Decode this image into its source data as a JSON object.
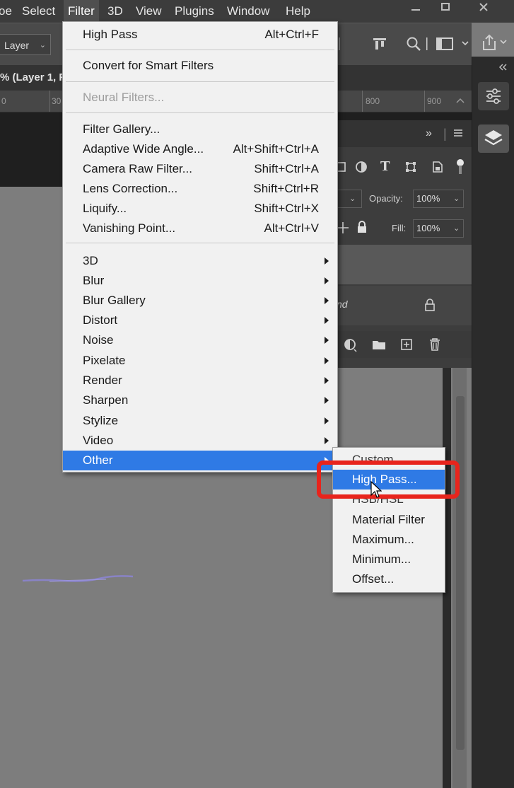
{
  "menubar": {
    "items": [
      {
        "label": "oe"
      },
      {
        "label": "Select"
      },
      {
        "label": "Filter"
      },
      {
        "label": "3D"
      },
      {
        "label": "View"
      },
      {
        "label": "Plugins"
      },
      {
        "label": "Window"
      },
      {
        "label": "Help"
      }
    ],
    "active_index": 2
  },
  "optionsbar": {
    "layer_select": "Layer"
  },
  "document": {
    "tab_title": "% (Layer 1, R"
  },
  "ruler": {
    "labels": [
      "0",
      "30",
      "800",
      "900"
    ]
  },
  "layers_panel": {
    "opacity_label": "Opacity:",
    "opacity_value": "100%",
    "fill_label": "Fill:",
    "fill_value": "100%",
    "background_layer_name": "nd"
  },
  "filter_menu": {
    "items": [
      {
        "label": "High Pass",
        "shortcut": "Alt+Ctrl+F"
      },
      {
        "label": "Convert for Smart Filters",
        "shortcut": ""
      },
      {
        "label": "Neural Filters...",
        "shortcut": "",
        "disabled": true
      },
      {
        "label": "Filter Gallery...",
        "shortcut": ""
      },
      {
        "label": "Adaptive Wide Angle...",
        "shortcut": "Alt+Shift+Ctrl+A"
      },
      {
        "label": "Camera Raw Filter...",
        "shortcut": "Shift+Ctrl+A"
      },
      {
        "label": "Lens Correction...",
        "shortcut": "Shift+Ctrl+R"
      },
      {
        "label": "Liquify...",
        "shortcut": "Shift+Ctrl+X"
      },
      {
        "label": "Vanishing Point...",
        "shortcut": "Alt+Ctrl+V"
      },
      {
        "label": "3D",
        "submenu": true
      },
      {
        "label": "Blur",
        "submenu": true
      },
      {
        "label": "Blur Gallery",
        "submenu": true
      },
      {
        "label": "Distort",
        "submenu": true
      },
      {
        "label": "Noise",
        "submenu": true
      },
      {
        "label": "Pixelate",
        "submenu": true
      },
      {
        "label": "Render",
        "submenu": true
      },
      {
        "label": "Sharpen",
        "submenu": true
      },
      {
        "label": "Stylize",
        "submenu": true
      },
      {
        "label": "Video",
        "submenu": true
      },
      {
        "label": "Other",
        "submenu": true,
        "highlighted": true
      }
    ]
  },
  "other_submenu": {
    "items": [
      {
        "label": "Custom..."
      },
      {
        "label": "High Pass...",
        "highlighted": true
      },
      {
        "label": "HSB/HSL"
      },
      {
        "label": "Material Filter"
      },
      {
        "label": "Maximum..."
      },
      {
        "label": "Minimum..."
      },
      {
        "label": "Offset..."
      }
    ]
  },
  "colors": {
    "menu_highlight": "#2f7ae5",
    "annotation_red": "#e8241c",
    "menu_background": "#f1f1f1",
    "app_dark": "#3c3c3c"
  }
}
